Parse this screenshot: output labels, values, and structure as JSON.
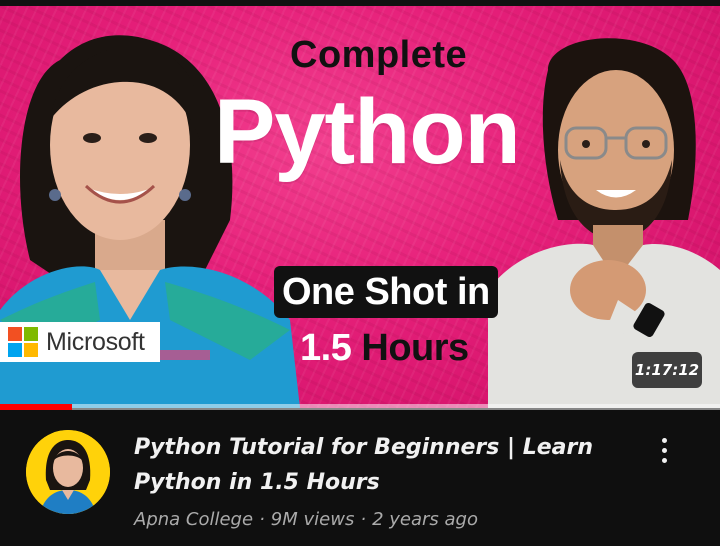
{
  "thumbnail": {
    "headline_top": "Complete",
    "headline_main": "Python",
    "tagline_box": "One Shot in",
    "tagline_num": "1.5",
    "tagline_word": "Hours",
    "brand_badge": "Microsoft",
    "duration": "1:17:12",
    "watch_progress": 0.1,
    "colors": {
      "background": "#e6207a",
      "progress": "#ff0000",
      "ms_red": "#f25022",
      "ms_green": "#7fba00",
      "ms_blue": "#00a4ef",
      "ms_yellow": "#ffb900"
    }
  },
  "video": {
    "title": "Python Tutorial for Beginners | Learn Python in 1.5 Hours",
    "channel": "Apna College",
    "views": "9M views",
    "age": "2 years ago",
    "separator": "·"
  },
  "icons": {
    "more": "more-vertical-icon",
    "avatar": "channel-avatar"
  }
}
